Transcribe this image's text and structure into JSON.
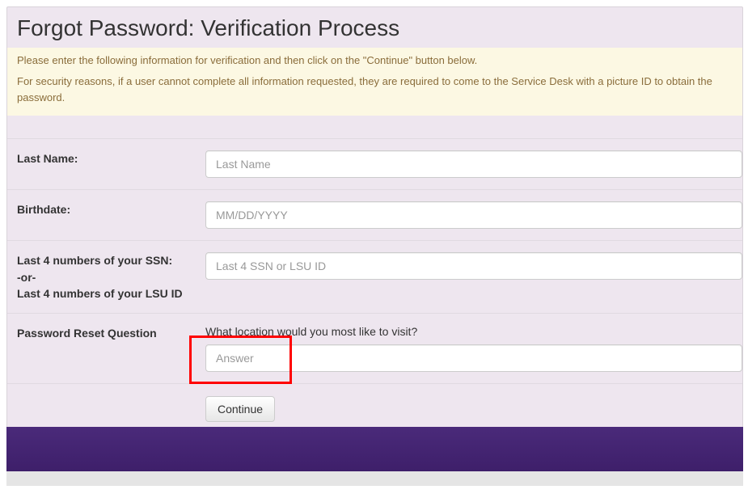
{
  "page": {
    "title": "Forgot Password: Verification Process"
  },
  "alert": {
    "line1": "Please enter the following information for verification and then click on the \"Continue\" button below.",
    "line2": "For security reasons, if a user cannot complete all information requested, they are required to come to the Service Desk with a picture ID to obtain the password."
  },
  "form": {
    "last_name": {
      "label": "Last Name:",
      "placeholder": "Last Name",
      "value": ""
    },
    "birthdate": {
      "label": "Birthdate:",
      "placeholder": "MM/DD/YYYY",
      "value": ""
    },
    "ssn": {
      "label_line1": "Last 4 numbers of your SSN:",
      "label_line2": "-or-",
      "label_line3": "Last 4 numbers of your LSU ID",
      "placeholder": "Last 4 SSN or LSU ID",
      "value": ""
    },
    "question": {
      "label": "Password Reset Question",
      "text": "What location would you most like to visit?",
      "placeholder": "Answer",
      "value": ""
    },
    "continue_label": "Continue"
  },
  "colors": {
    "panel_bg": "#eee6ef",
    "alert_bg": "#fcf8e3",
    "footer_bg": "#3e1f6a",
    "highlight": "#ff0000"
  }
}
